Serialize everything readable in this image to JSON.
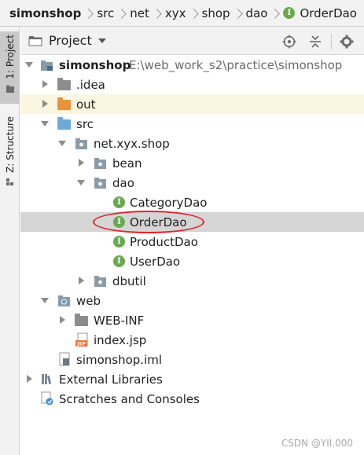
{
  "breadcrumb": {
    "items": [
      "simonshop",
      "src",
      "net",
      "xyx",
      "shop",
      "dao",
      "OrderDao"
    ]
  },
  "toolstrip": {
    "tabs": [
      {
        "label": "1: Project",
        "active": true
      },
      {
        "label": "Z: Structure",
        "active": false
      }
    ]
  },
  "panel": {
    "title": "Project",
    "buttons": [
      "target-icon",
      "collapse-all-icon",
      "gear-icon"
    ]
  },
  "tree": {
    "root_label": "simonshop",
    "root_path": "E:\\web_work_s2\\practice\\simonshop",
    "idea": ".idea",
    "out": "out",
    "src": "src",
    "package": "net.xyx.shop",
    "bean": "bean",
    "dao": "dao",
    "category_dao": "CategoryDao",
    "order_dao": "OrderDao",
    "product_dao": "ProductDao",
    "user_dao": "UserDao",
    "dbutil": "dbutil",
    "web": "web",
    "web_inf": "WEB-INF",
    "index_jsp": "index.jsp",
    "iml": "simonshop.iml",
    "external_libraries": "External Libraries",
    "scratches": "Scratches and Consoles",
    "selected": "OrderDao"
  },
  "colors": {
    "selection": "#d5d5d5",
    "highlight_ring": "#e0262b",
    "interface_badge": "#6aa84f",
    "src_folder": "#6fa9d8",
    "out_folder": "#e8943c"
  },
  "watermark": "CSDN @YII.000"
}
